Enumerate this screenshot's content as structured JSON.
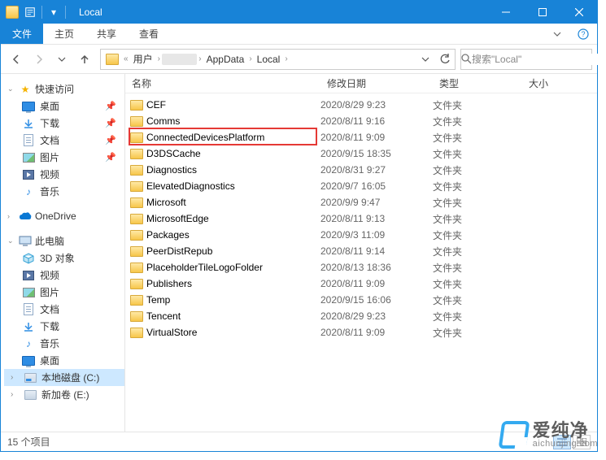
{
  "window": {
    "title": "Local"
  },
  "menubar": {
    "file": "文件",
    "home": "主页",
    "share": "共享",
    "view": "查看"
  },
  "address": {
    "crumbs": [
      "用户",
      "",
      "AppData",
      "Local"
    ]
  },
  "search": {
    "placeholder": "搜索\"Local\""
  },
  "sidebar": {
    "quick": {
      "label": "快速访问",
      "items": [
        {
          "label": "桌面",
          "icon": "desktop",
          "pinned": true
        },
        {
          "label": "下载",
          "icon": "down",
          "pinned": true
        },
        {
          "label": "文档",
          "icon": "doc",
          "pinned": true
        },
        {
          "label": "图片",
          "icon": "pic",
          "pinned": true
        },
        {
          "label": "视频",
          "icon": "vid",
          "pinned": false
        },
        {
          "label": "音乐",
          "icon": "music",
          "pinned": false
        }
      ]
    },
    "onedrive": {
      "label": "OneDrive"
    },
    "pc": {
      "label": "此电脑",
      "items": [
        {
          "label": "3D 对象",
          "icon": "3d"
        },
        {
          "label": "视频",
          "icon": "vid"
        },
        {
          "label": "图片",
          "icon": "pic"
        },
        {
          "label": "文档",
          "icon": "doc"
        },
        {
          "label": "下载",
          "icon": "down"
        },
        {
          "label": "音乐",
          "icon": "music"
        },
        {
          "label": "桌面",
          "icon": "desktop"
        },
        {
          "label": "本地磁盘 (C:)",
          "icon": "disk-c"
        },
        {
          "label": "新加卷 (E:)",
          "icon": "disk"
        }
      ]
    }
  },
  "columns": {
    "name": "名称",
    "date": "修改日期",
    "type": "类型",
    "size": "大小"
  },
  "items": [
    {
      "name": "CEF",
      "date": "2020/8/29 9:23",
      "type": "文件夹"
    },
    {
      "name": "Comms",
      "date": "2020/8/11 9:16",
      "type": "文件夹"
    },
    {
      "name": "ConnectedDevicesPlatform",
      "date": "2020/8/11 9:09",
      "type": "文件夹",
      "highlight": true
    },
    {
      "name": "D3DSCache",
      "date": "2020/9/15 18:35",
      "type": "文件夹"
    },
    {
      "name": "Diagnostics",
      "date": "2020/8/31 9:27",
      "type": "文件夹"
    },
    {
      "name": "ElevatedDiagnostics",
      "date": "2020/9/7 16:05",
      "type": "文件夹"
    },
    {
      "name": "Microsoft",
      "date": "2020/9/9 9:47",
      "type": "文件夹"
    },
    {
      "name": "MicrosoftEdge",
      "date": "2020/8/11 9:13",
      "type": "文件夹"
    },
    {
      "name": "Packages",
      "date": "2020/9/3 11:09",
      "type": "文件夹"
    },
    {
      "name": "PeerDistRepub",
      "date": "2020/8/11 9:14",
      "type": "文件夹"
    },
    {
      "name": "PlaceholderTileLogoFolder",
      "date": "2020/8/13 18:36",
      "type": "文件夹"
    },
    {
      "name": "Publishers",
      "date": "2020/8/11 9:09",
      "type": "文件夹"
    },
    {
      "name": "Temp",
      "date": "2020/9/15 16:06",
      "type": "文件夹"
    },
    {
      "name": "Tencent",
      "date": "2020/8/29 9:23",
      "type": "文件夹"
    },
    {
      "name": "VirtualStore",
      "date": "2020/8/11 9:09",
      "type": "文件夹"
    }
  ],
  "status": {
    "count": "15 个项目"
  },
  "watermark": {
    "cn": "爱纯净",
    "en": "aichunjing.com"
  }
}
